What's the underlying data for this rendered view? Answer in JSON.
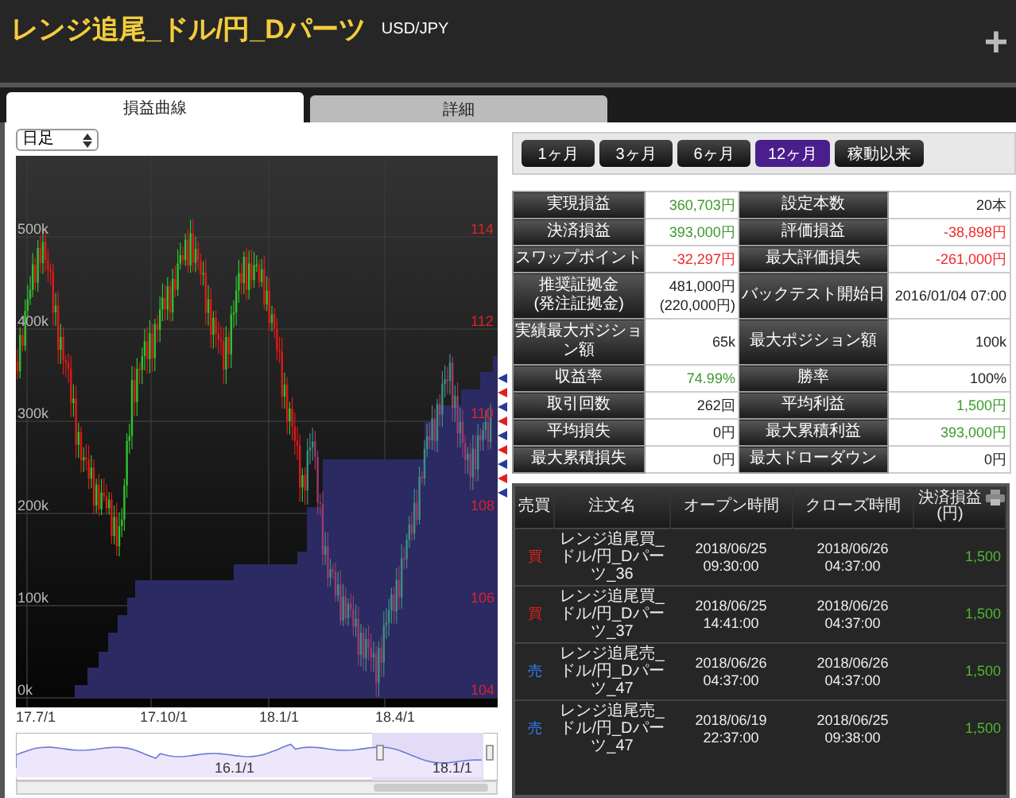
{
  "header": {
    "title": "レンジ追尾_ドル/円_Dパーツ",
    "symbol": "USD/JPY",
    "add_button": "+"
  },
  "tabs": [
    {
      "label": "損益曲線",
      "selected": true
    },
    {
      "label": "詳細",
      "selected": false
    }
  ],
  "interval_select": {
    "value": "日足"
  },
  "chart": {
    "left_ticks": [
      "500k",
      "400k",
      "300k",
      "200k",
      "100k",
      "0k"
    ],
    "right_ticks": [
      "114",
      "112",
      "110",
      "108",
      "106",
      "104"
    ],
    "x_ticks": [
      "17.7/1",
      "17.10/1",
      "18.1/1",
      "18.4/1"
    ]
  },
  "navigator": {
    "labels": [
      "16.1/1",
      "18.1/1"
    ]
  },
  "periods": [
    {
      "label": "1ヶ月",
      "selected": false
    },
    {
      "label": "3ヶ月",
      "selected": false
    },
    {
      "label": "6ヶ月",
      "selected": false
    },
    {
      "label": "12ヶ月",
      "selected": true
    },
    {
      "label": "稼動以来",
      "selected": false
    }
  ],
  "stats": [
    {
      "cells": [
        {
          "label": "実現損益",
          "value": "360,703円",
          "kind": "positive"
        },
        {
          "label": "設定本数",
          "value": "20本",
          "kind": "neutral"
        }
      ]
    },
    {
      "cells": [
        {
          "label": "決済損益",
          "value": "393,000円",
          "kind": "positive"
        },
        {
          "label": "評価損益",
          "value": "-38,898円",
          "kind": "negative"
        }
      ]
    },
    {
      "cells": [
        {
          "label": "スワップポイント",
          "value": "-32,297円",
          "kind": "negative"
        },
        {
          "label": "最大評価損失",
          "value": "-261,000円",
          "kind": "negative"
        }
      ]
    },
    {
      "cells": [
        {
          "label": "推奨証拠金\n(発注証拠金)",
          "value": "481,000円\n(220,000円)",
          "kind": "neutral"
        },
        {
          "label": "バックテスト開始日",
          "value": "2016/01/04 07:00",
          "kind": "neutral"
        }
      ]
    },
    {
      "cells": [
        {
          "label": "実績最大ポジション額",
          "value": "65k",
          "kind": "neutral"
        },
        {
          "label": "最大ポジション額",
          "value": "100k",
          "kind": "neutral"
        }
      ]
    },
    {
      "cells": [
        {
          "label": "収益率",
          "value": "74.99%",
          "kind": "positive"
        },
        {
          "label": "勝率",
          "value": "100%",
          "kind": "neutral"
        }
      ]
    },
    {
      "cells": [
        {
          "label": "取引回数",
          "value": "262回",
          "kind": "neutral"
        },
        {
          "label": "平均利益",
          "value": "1,500円",
          "kind": "positive"
        }
      ]
    },
    {
      "cells": [
        {
          "label": "平均損失",
          "value": "0円",
          "kind": "neutral"
        },
        {
          "label": "最大累積利益",
          "value": "393,000円",
          "kind": "positive"
        }
      ]
    },
    {
      "cells": [
        {
          "label": "最大累積損失",
          "value": "0円",
          "kind": "neutral"
        },
        {
          "label": "最大ドローダウン",
          "value": "0円",
          "kind": "neutral"
        }
      ]
    }
  ],
  "trades": {
    "columns": [
      "売買",
      "注文名",
      "オープン時間",
      "クローズ時間",
      "決済損益\n(円)"
    ],
    "rows": [
      {
        "kind": "buy",
        "side": "買",
        "name": "レンジ追尾買_ドル/円_Dパーツ_36",
        "open": "2018/06/25\n09:30:00",
        "close": "2018/06/26\n04:37:00",
        "pl": "1,500"
      },
      {
        "kind": "buy",
        "side": "買",
        "name": "レンジ追尾買_ドル/円_Dパーツ_37",
        "open": "2018/06/25\n14:41:00",
        "close": "2018/06/26\n04:37:00",
        "pl": "1,500"
      },
      {
        "kind": "sell",
        "side": "売",
        "name": "レンジ追尾売_ドル/円_Dパーツ_47",
        "open": "2018/06/26\n04:37:00",
        "close": "2018/06/26\n04:37:00",
        "pl": "1,500"
      },
      {
        "kind": "sell",
        "side": "売",
        "name": "レンジ追尾売_ドル/円_Dパーツ_47",
        "open": "2018/06/19\n22:37:00",
        "close": "2018/06/25\n09:38:00",
        "pl": "1,500"
      }
    ]
  }
}
